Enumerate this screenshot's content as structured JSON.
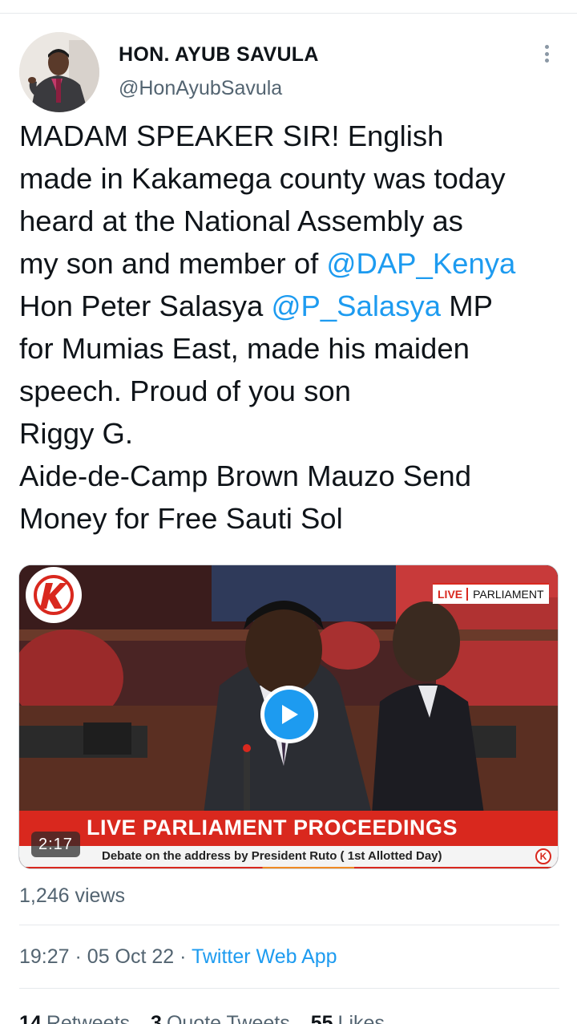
{
  "tweet": {
    "author": {
      "name": "HON. AYUB SAVULA",
      "handle": "@HonAyubSavula"
    },
    "text": {
      "line1": "MADAM SPEAKER SIR! English",
      "line2": "made in Kakamega county was today",
      "line3": "heard at the National Assembly as",
      "line4_pre": "my son and member of ",
      "mention1": "@DAP_Kenya",
      "line5_pre": "Hon Peter Salasya ",
      "mention2": "@P_Salasya",
      "line5_post": " MP",
      "line6": "for Mumias East, made his maiden",
      "line7": "speech. Proud of you son",
      "line8": "Riggy G.",
      "line9": "Aide-de-Camp Brown Mauzo Send",
      "line10": "Money for Free Sauti Sol"
    },
    "media": {
      "live_label": "LIVE",
      "channel_label": "PARLIAMENT",
      "banner_title": "LIVE PARLIAMENT PROCEEDINGS",
      "banner_subtitle": "Debate on the address by President Ruto ( 1st Allotted Day)",
      "duration": "2:17",
      "logo_icon": "k24-logo-icon",
      "play_icon": "play-icon"
    },
    "views": "1,246 views",
    "time": "19:27",
    "date": "05 Oct 22",
    "source": "Twitter Web App",
    "separator": "·",
    "stats": {
      "retweets_count": "14",
      "retweets_label": "Retweets",
      "quotes_count": "3",
      "quotes_label": "Quote Tweets",
      "likes_count": "55",
      "likes_label": "Likes"
    }
  },
  "colors": {
    "link": "#1d9bf0",
    "secondary_text": "#536471",
    "banner_red": "#d9281e"
  }
}
